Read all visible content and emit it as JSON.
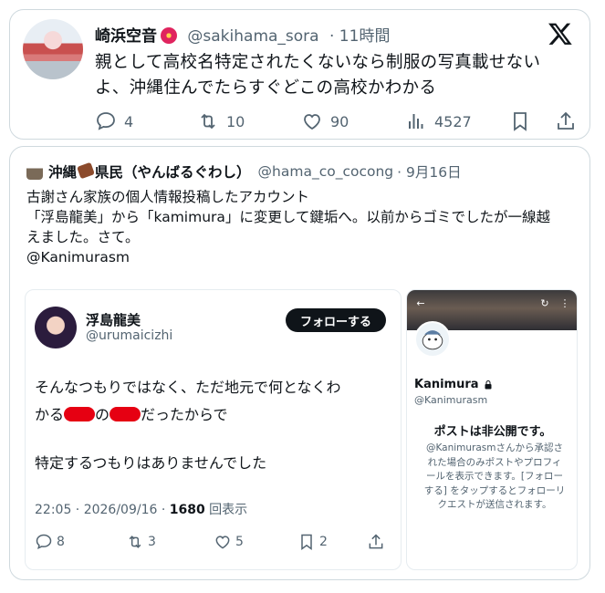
{
  "tweet1": {
    "display_name": "崎浜空音",
    "handle": "@sakihama_sora",
    "time": "· 11時間",
    "text": "親として高校名特定されたくないなら制服の写真載せないよ、沖縄住んでたらすぐどこの高校かわかる",
    "replies": "4",
    "retweets": "10",
    "likes": "90",
    "views": "4527"
  },
  "tweet2": {
    "display_name_a": "沖縄",
    "display_name_b": "県民（やんばるぐわし）",
    "handle": "@hama_co_cocong",
    "time": "· 9月16日",
    "lines": [
      "古謝さん家族の個人情報投稿したアカウント",
      "「浮島龍美」から「kamimura」に変更して鍵垢へ。以前からゴミでしたが一線越",
      "えました。さて。",
      "@Kanimurasm"
    ]
  },
  "inner_left": {
    "display_name": "浮島龍美",
    "handle": "@urumaicizhi",
    "follow_label": "フォローする",
    "line1": "そんなつもりではなく、ただ地元で何となくわ",
    "line2_a": "かる",
    "line2_b": "の",
    "line2_c": "だったからで",
    "line3": "特定するつもりはありませんでした",
    "meta_time": "22:05 · 2026/09/16 · ",
    "meta_views": "1680",
    "meta_views_label": " 回表示",
    "replies": "8",
    "retweets": "3",
    "likes": "5",
    "bookmarks": "2"
  },
  "inner_right": {
    "display_name": "Kanimura",
    "handle": "@Kanimurasm",
    "private_title": "ポストは非公開です。",
    "private_text": "@Kanimurasmさんから承認された場合のみポストやプロフィールを表示できます。[フォローする] をタップするとフォローリクエストが送信されます。"
  },
  "icons": {
    "x_logo": "x-logo-icon",
    "reply": "reply-icon",
    "retweet": "retweet-icon",
    "like": "heart-icon",
    "views": "views-icon",
    "bookmark": "bookmark-icon",
    "share": "share-icon",
    "lock": "lock-icon"
  },
  "colors": {
    "text": "#0f1419",
    "muted": "#536471",
    "border": "#cfd9de",
    "redaction": "#e60012"
  }
}
